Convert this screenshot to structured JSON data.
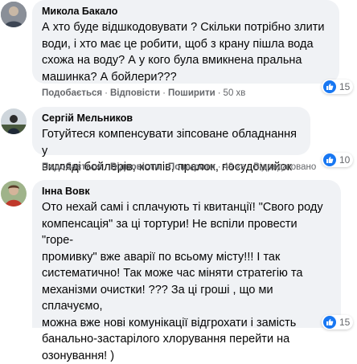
{
  "comments": [
    {
      "author": "Микола Бакало",
      "lines": [
        "А хто буде відшкодовувати ? Скільки потрібно злити",
        "води, і хто має це робити, щоб з крану пішла вода",
        "схожа на воду? А у кого була вмикнена пральна",
        "машинка? А бойлери???"
      ],
      "actions": {
        "like": "Подобається",
        "reply": "Відповісти",
        "share": "Поширити",
        "time": "50 хв"
      },
      "reactions": {
        "count": "15",
        "type": "like-icon"
      }
    },
    {
      "author": "Сергій Мельников",
      "lines": [
        "Готуйтеся компенсувати зіпсоване обладнання у",
        "вигляді бойлерів, котлів, пралок, посудомийок"
      ],
      "actions": {
        "like": "Подобається",
        "reply": "Відповісти",
        "share": "Поширити",
        "time": "49 хв",
        "edited": "Відредаговано"
      },
      "reactions": {
        "count": "10",
        "type": "like-icon"
      }
    },
    {
      "author": "Інна Вовк",
      "lines": [
        "Ото нехай самі і сплачують ті квитанції! \"Свого роду",
        "компенсація\" за ці тортури! Не вспіли провести \"горе-",
        "промивку\" вже аварії по всьому місту!!! І так",
        "систематично! Так може час міняти стратегію та",
        "механізми очистки! ??? За ці гроші , що ми сплачуємо,",
        "можна вже нові комунікації відгрохати і замість",
        "банально-застарілого хлорування перейти на",
        "озонування! )"
      ],
      "reactions": {
        "count": "15",
        "type": "like-icon"
      }
    }
  ],
  "colors": {
    "bubble": "#f0f2f5",
    "meta": "#65676b",
    "like": "#1877f2"
  }
}
